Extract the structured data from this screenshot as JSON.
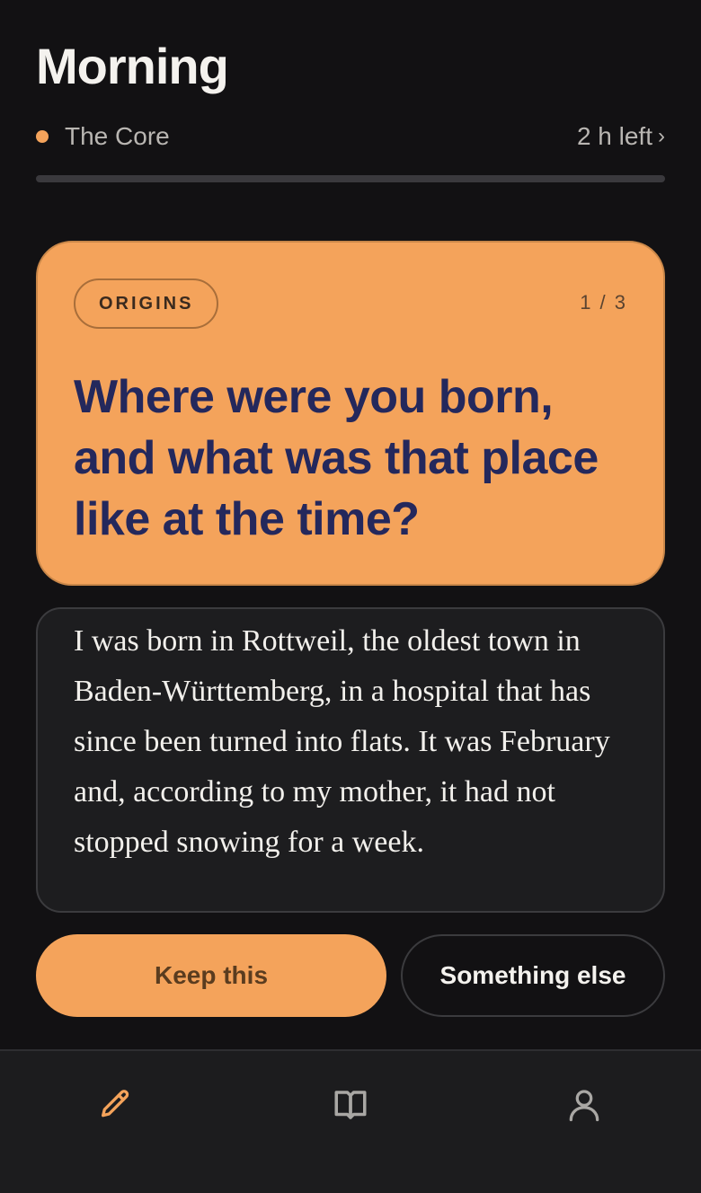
{
  "header": {
    "title": "Morning"
  },
  "session": {
    "name": "The Core",
    "time_left": "2 h left",
    "progress_fraction": 0,
    "accent_color": "#f4a35b"
  },
  "prompt": {
    "category": "ORIGINS",
    "counter": "1 / 3",
    "question": "Where were you born, and what was that place like at the time?",
    "card_color": "#f4a35b",
    "question_color": "#24285c"
  },
  "answer": {
    "text": "I was born in Rottweil, the oldest town in Baden-Württemberg, in a hospital that has since been turned into flats. It was February and, according to my mother, it had not stopped snowing for a week."
  },
  "actions": {
    "keep_label": "Keep this",
    "else_label": "Something else"
  },
  "nav": {
    "items": [
      {
        "icon": "pencil-icon",
        "active": true
      },
      {
        "icon": "book-icon",
        "active": false
      },
      {
        "icon": "user-icon",
        "active": false
      }
    ]
  }
}
